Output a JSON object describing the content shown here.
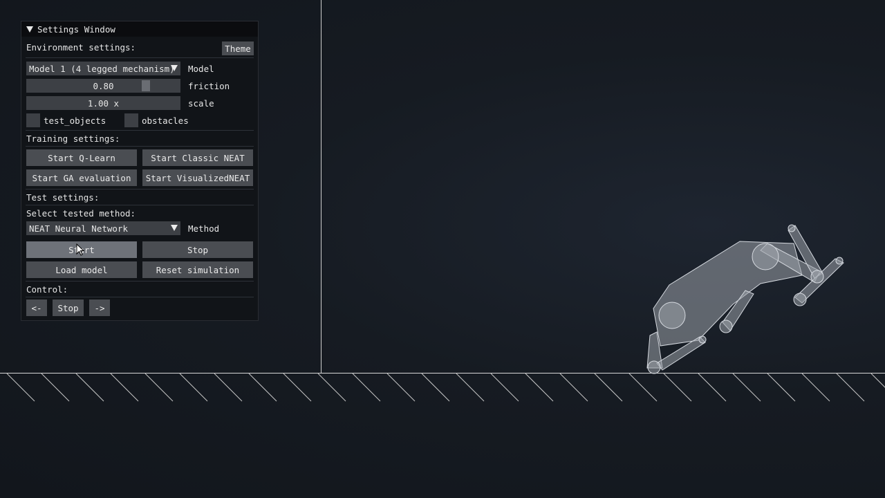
{
  "settings_window": {
    "title": "Settings Window",
    "environment": {
      "header": "Environment settings:",
      "theme_button": "Theme",
      "model_select_value": "Model 1 (4 legged mechanism)",
      "model_label": "Model",
      "friction_value": "0.80",
      "friction_label": "friction",
      "scale_value": "1.00 x",
      "scale_label": "scale",
      "test_objects_label": "test_objects",
      "obstacles_label": "obstacles"
    },
    "training": {
      "header": "Training settings:",
      "buttons": [
        "Start Q-Learn",
        "Start Classic NEAT",
        "Start GA evaluation",
        "Start VisualizedNEAT"
      ]
    },
    "test": {
      "header": "Test settings:",
      "select_label": "Select tested method:",
      "method_value": "NEAT Neural Network",
      "method_label": "Method",
      "start_button": "Start",
      "stop_button": "Stop",
      "load_button": "Load model",
      "reset_button": "Reset simulation"
    },
    "control": {
      "header": "Control:",
      "left_button": "<-",
      "stop_button": "Stop",
      "right_button": "->"
    }
  },
  "colors": {
    "background": "#161b22",
    "ground_line": "#d8d8d8",
    "robot_fill": "#9aa0a8",
    "button": "#4a4d52",
    "button_active": "#6e7279"
  }
}
